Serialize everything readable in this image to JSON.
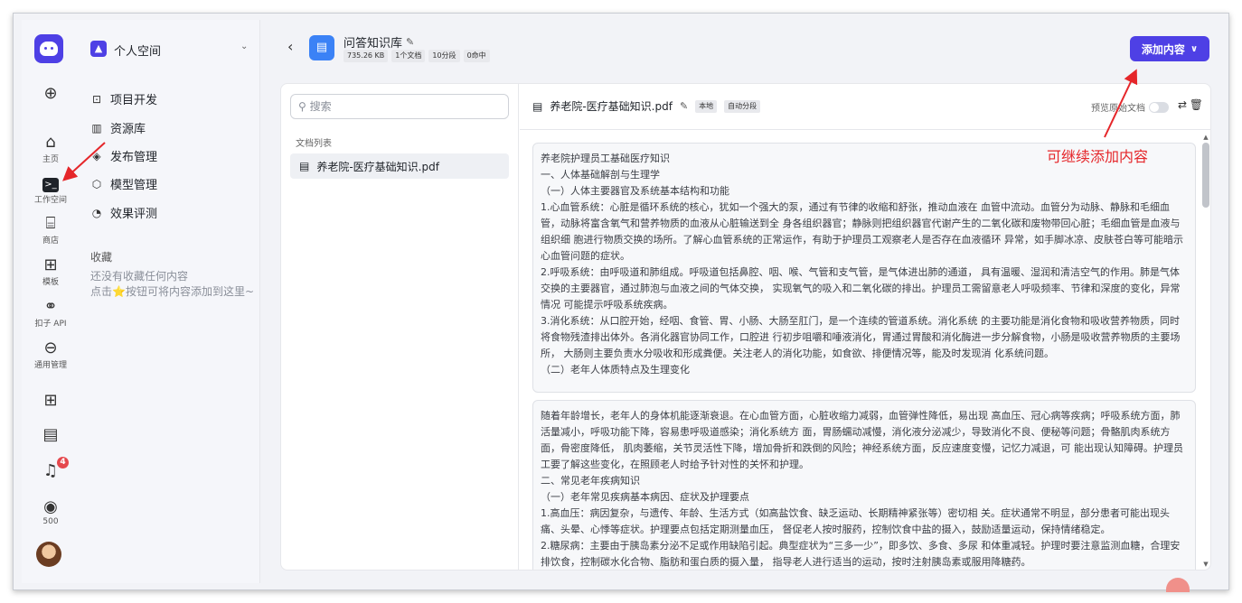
{
  "sidebar_icons": [
    {
      "icon": "plus-circle-icon",
      "label": ""
    },
    {
      "icon": "home-icon",
      "label": "主页"
    },
    {
      "icon": "workspace-icon",
      "label": "工作空间"
    },
    {
      "icon": "store-icon",
      "label": "商店"
    },
    {
      "icon": "template-icon",
      "label": "模板"
    },
    {
      "icon": "api-icon",
      "label": "扣子 API"
    },
    {
      "icon": "general-manage-icon",
      "label": "通用管理"
    },
    {
      "icon": "apps-icon",
      "label": ""
    },
    {
      "icon": "document-icon",
      "label": ""
    },
    {
      "icon": "bell-icon",
      "label": "",
      "badge": "4"
    },
    {
      "icon": "credit-icon",
      "label": "500"
    }
  ],
  "space": {
    "name": "个人空间"
  },
  "menu": {
    "items": [
      {
        "icon": "project-icon",
        "label": "项目开发"
      },
      {
        "icon": "resource-icon",
        "label": "资源库"
      },
      {
        "icon": "publish-icon",
        "label": "发布管理"
      },
      {
        "icon": "model-icon",
        "label": "模型管理"
      },
      {
        "icon": "eval-icon",
        "label": "效果评测"
      }
    ],
    "favorites_title": "收藏",
    "favorites_empty_line1": "还没有收藏任何内容",
    "favorites_empty_line2": "点击⭐按钮可将内容添加到这里~"
  },
  "kb": {
    "title": "问答知识库",
    "tags": [
      "735.26 KB",
      "1个文档",
      "10分段",
      "0命中"
    ],
    "add_button": "添加内容"
  },
  "left_panel": {
    "search_placeholder": "搜索",
    "list_label": "文档列表",
    "documents": [
      "养老院-医疗基础知识.pdf"
    ]
  },
  "doc": {
    "title": "养老院-医疗基础知识.pdf",
    "tags": [
      "本地",
      "自动分段"
    ],
    "preview_label": "预览原始文档"
  },
  "segments": [
    [
      "养老院护理员工基础医疗知识",
      "一、人体基础解剖与生理学",
      "（一）人体主要器官及系统基本结构和功能",
      "1.心血管系统：心脏是循环系统的核心，犹如一个强大的泵，通过有节律的收缩和舒张，推动血液在 血管中流动。血管分为动脉、静脉和毛细血管，动脉将富含氧气和营养物质的血液从心脏输送到全 身各组织器官；静脉则把组织器官代谢产生的二氧化碳和废物带回心脏；毛细血管是血液与组织细 胞进行物质交换的场所。了解心血管系统的正常运作，有助于护理员工观察老人是否存在血液循环 异常，如手脚冰凉、皮肤苍白等可能暗示心血管问题的症状。",
      "2.呼吸系统：由呼吸道和肺组成。呼吸道包括鼻腔、咽、喉、气管和支气管，是气体进出肺的通道， 具有温暖、湿润和清洁空气的作用。肺是气体交换的主要器官，通过肺泡与血液之间的气体交换， 实现氧气的吸入和二氧化碳的排出。护理员工需留意老人呼吸频率、节律和深度的变化，异常情况 可能提示呼吸系统疾病。",
      "3.消化系统：从口腔开始，经咽、食管、胃、小肠、大肠至肛门，是一个连续的管道系统。消化系统 的主要功能是消化食物和吸收营养物质，同时将食物残渣排出体外。各消化器官协同工作，口腔进 行初步咀嚼和唾液消化，胃通过胃酸和消化酶进一步分解食物，小肠是吸收营养物质的主要场所， 大肠则主要负责水分吸收和形成粪便。关注老人的消化功能，如食欲、排便情况等，能及时发现消 化系统问题。",
      "（二）老年人体质特点及生理变化"
    ],
    [
      "随着年龄增长，老年人的身体机能逐渐衰退。在心血管方面，心脏收缩力减弱，血管弹性降低，易出现 高血压、冠心病等疾病；呼吸系统方面，肺活量减小，呼吸功能下降，容易患呼吸道感染；消化系统方 面，胃肠蠕动减慢，消化液分泌减少，导致消化不良、便秘等问题；骨骼肌肉系统方面，骨密度降低， 肌肉萎缩，关节灵活性下降，增加骨折和跌倒的风险；神经系统方面，反应速度变慢，记忆力减退，可 能出现认知障碍。护理员工要了解这些变化，在照顾老人时给予针对性的关怀和护理。",
      "二、常见老年疾病知识",
      "（一）老年常见疾病基本病因、症状及护理要点",
      "1.高血压：病因复杂，与遗传、年龄、生活方式（如高盐饮食、缺乏运动、长期精神紧张等）密切相 关。症状通常不明显，部分患者可能出现头痛、头晕、心悸等症状。护理要点包括定期测量血压， 督促老人按时服药，控制饮食中盐的摄入，鼓励适量运动，保持情绪稳定。",
      "2.糖尿病：主要由于胰岛素分泌不足或作用缺陷引起。典型症状为“三多一少”，即多饮、多食、多尿 和体重减轻。护理时要注意监测血糖，合理安排饮食，控制碳水化合物、脂肪和蛋白质的摄入量， 指导老人进行适当的运动，按时注射胰岛素或服用降糖药。"
    ]
  ],
  "annotation": "可继续添加内容",
  "colors": {
    "brand": "#4e40e5",
    "annotation": "#e5262a",
    "kb_icon": "#3b82f6"
  }
}
